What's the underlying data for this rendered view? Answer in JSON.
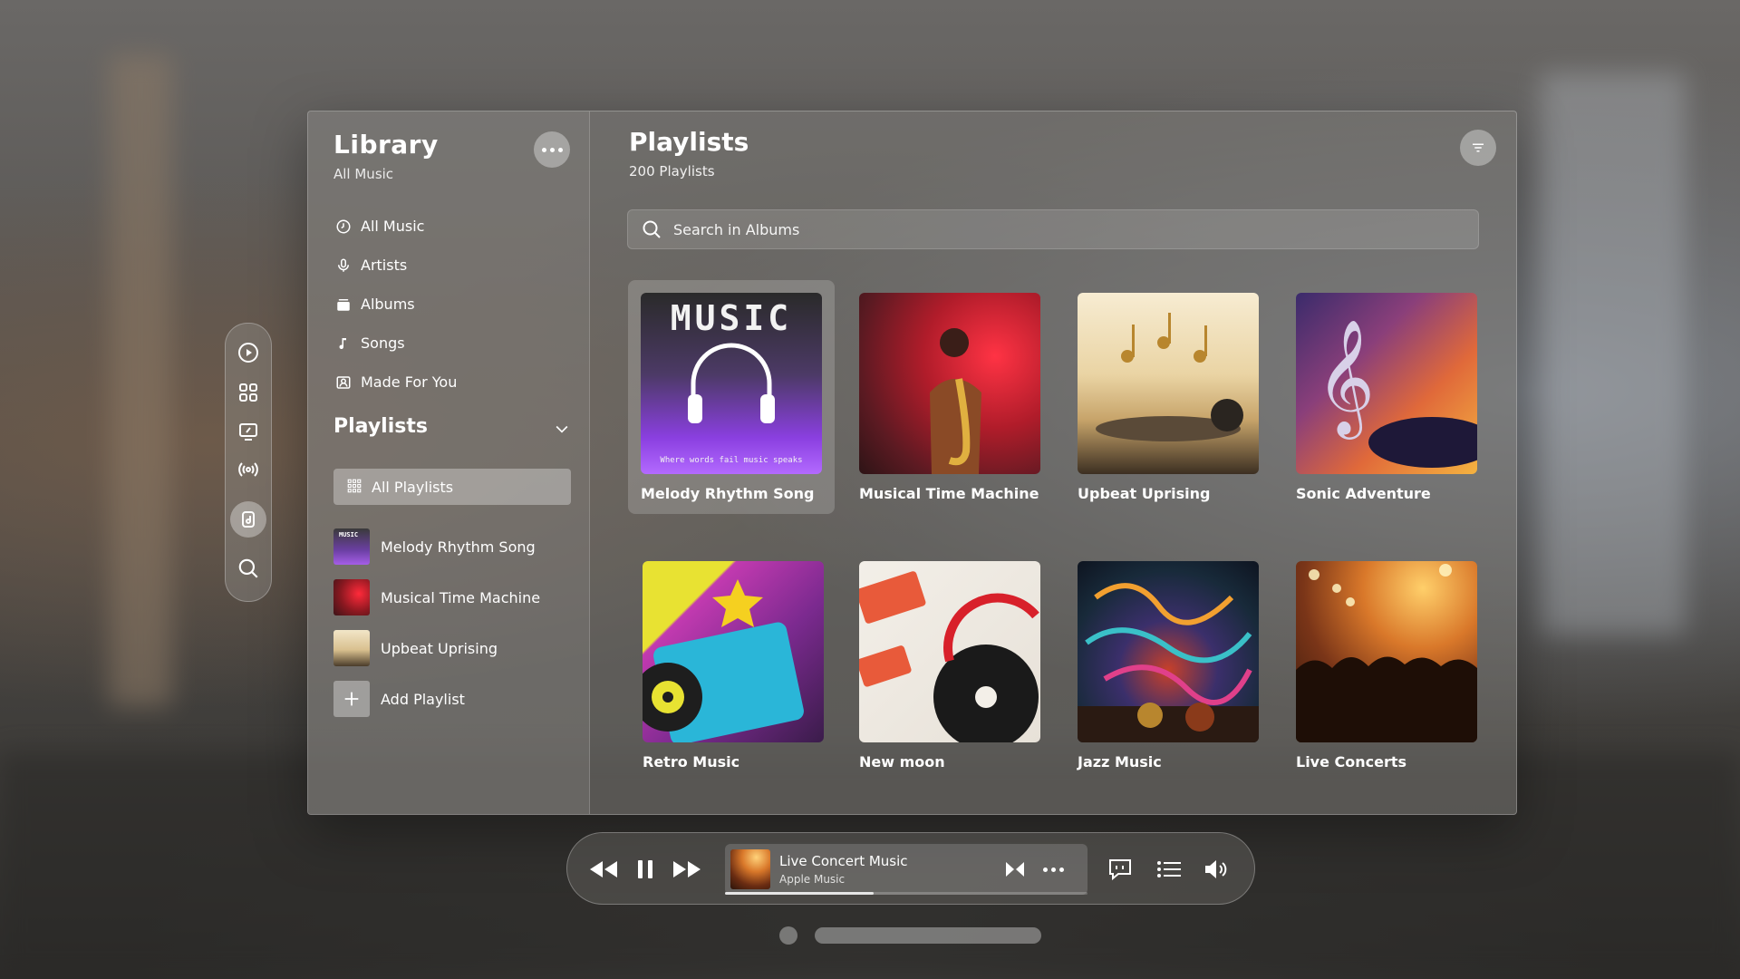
{
  "library": {
    "title": "Library",
    "subtitle": "All Music",
    "nav": [
      {
        "label": "All Music",
        "icon": "clock-icon"
      },
      {
        "label": "Artists",
        "icon": "microphone-icon"
      },
      {
        "label": "Albums",
        "icon": "album-icon"
      },
      {
        "label": "Songs",
        "icon": "music-note-icon"
      },
      {
        "label": "Made For You",
        "icon": "person-card-icon"
      }
    ]
  },
  "playlists_section": {
    "title": "Playlists",
    "all_label": "All Playlists",
    "items": [
      {
        "label": "Melody Rhythm Song"
      },
      {
        "label": "Musical Time Machine"
      },
      {
        "label": "Upbeat Uprising"
      }
    ],
    "add_label": "Add Playlist"
  },
  "content": {
    "title": "Playlists",
    "subtitle": "200 Playlists",
    "search_placeholder": "Search in Albums",
    "cards": [
      {
        "label": "Melody Rhythm Song",
        "art_word": "MUSIC",
        "art_tagline": "Where words fail music speaks"
      },
      {
        "label": "Musical Time Machine"
      },
      {
        "label": "Upbeat Uprising"
      },
      {
        "label": "Sonic Adventure"
      },
      {
        "label": "Retro Music"
      },
      {
        "label": "New moon"
      },
      {
        "label": "Jazz Music"
      },
      {
        "label": "Live Concerts"
      }
    ]
  },
  "player": {
    "title": "Live Concert Music",
    "artist": "Apple Music",
    "progress": 0.41
  },
  "colors": {
    "accent_selected": "rgba(255,255,255,0.35)",
    "text": "#ffffff"
  }
}
